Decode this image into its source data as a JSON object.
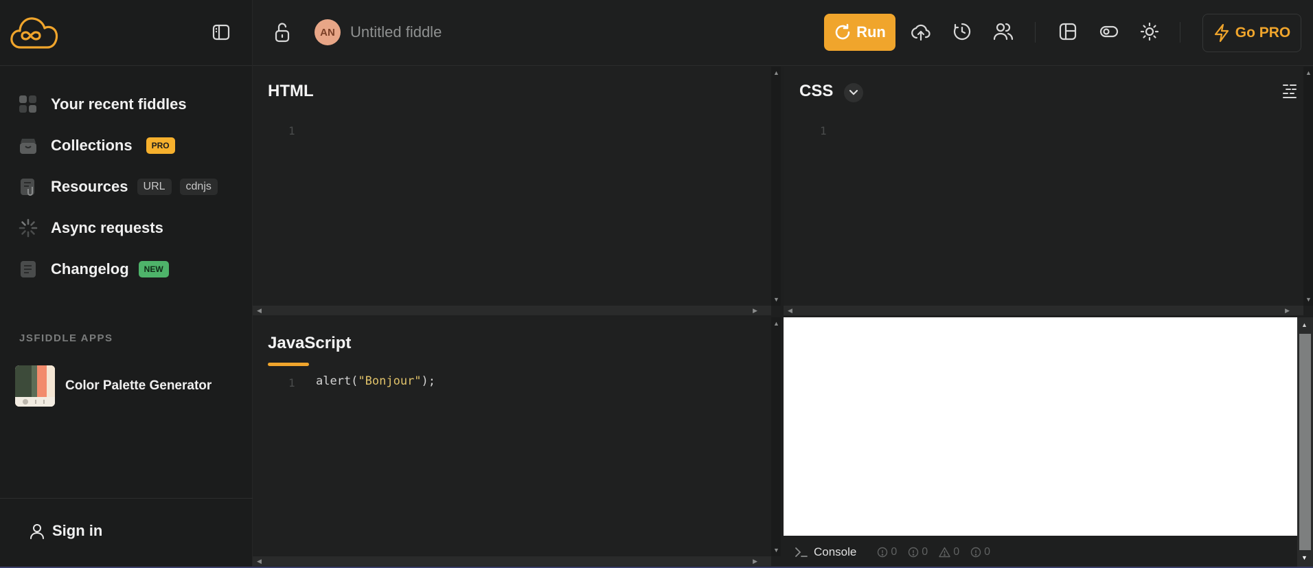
{
  "sidebar": {
    "nav": [
      {
        "label": "Your recent fiddles"
      },
      {
        "label": "Collections",
        "badge": "PRO"
      },
      {
        "label": "Resources",
        "tags": [
          "URL",
          "cdnjs"
        ]
      },
      {
        "label": "Async requests"
      },
      {
        "label": "Changelog",
        "badge": "NEW"
      }
    ],
    "apps_heading": "JSFIDDLE APPS",
    "apps": [
      {
        "label": "Color Palette Generator"
      }
    ],
    "signin_label": "Sign in"
  },
  "topbar": {
    "avatar_initials": "AN",
    "title_placeholder": "Untitled fiddle",
    "run_label": "Run",
    "gopro_label": "Go PRO"
  },
  "editors": {
    "html": {
      "title": "HTML",
      "line_numbers": [
        "1"
      ],
      "code": ""
    },
    "css": {
      "title": "CSS",
      "line_numbers": [
        "1"
      ],
      "code": ""
    },
    "javascript": {
      "title": "JavaScript",
      "line_numbers": [
        "1"
      ],
      "code_prefix": "alert(",
      "code_string": "\"Bonjour\"",
      "code_suffix": ");"
    }
  },
  "console": {
    "label": "Console",
    "counts": {
      "info": "0",
      "error": "0",
      "warning": "0",
      "log": "0"
    }
  },
  "colors": {
    "accent": "#f0a52c",
    "background": "#1e1f1f",
    "sidebar": "#1b1c1c",
    "badge_pro": "#f6b02d",
    "badge_new": "#4eb36a",
    "avatar": "#e8a687"
  },
  "icons": {
    "logo": "cloud-infinity-icon",
    "sidebar_toggle": "sidebar-toggle-icon",
    "lock": "unlock-icon",
    "run": "refresh-icon",
    "save": "cloud-upload-icon",
    "history": "history-icon",
    "collaborate": "users-icon",
    "layout": "layout-icon",
    "settings": "toggle-icon",
    "theme": "sun-icon",
    "gopro": "lightning-icon"
  }
}
